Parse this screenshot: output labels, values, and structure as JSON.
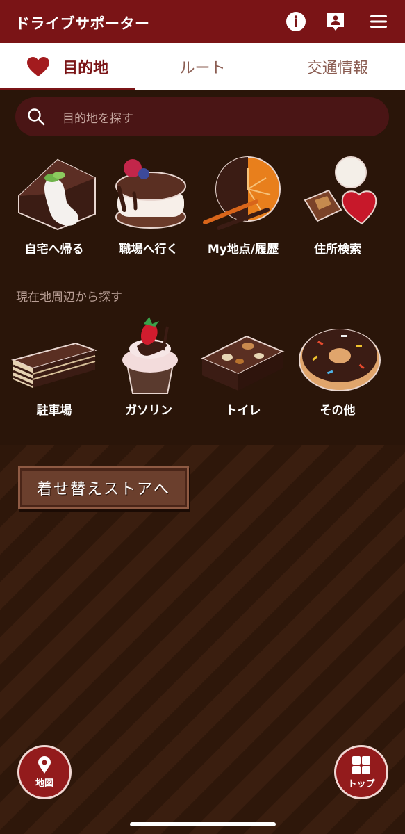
{
  "header": {
    "title": "ドライブサポーター"
  },
  "tabs": [
    {
      "label": "目的地"
    },
    {
      "label": "ルート"
    },
    {
      "label": "交通情報"
    }
  ],
  "search": {
    "placeholder": "目的地を探す"
  },
  "shortcuts": [
    {
      "label": "自宅へ帰る",
      "icon": "chocolate-cake-icon"
    },
    {
      "label": "職場へ行く",
      "icon": "macaron-icon"
    },
    {
      "label": "My地点/履歴",
      "icon": "orange-chocolate-icon"
    },
    {
      "label": "住所検索",
      "icon": "bonbon-chocolates-icon"
    }
  ],
  "nearby": {
    "title": "現在地周辺から探す",
    "items": [
      {
        "label": "駐車場",
        "icon": "opera-cake-icon"
      },
      {
        "label": "ガソリン",
        "icon": "cupcake-icon"
      },
      {
        "label": "トイレ",
        "icon": "brownie-icon"
      },
      {
        "label": "その他",
        "icon": "donut-icon"
      }
    ]
  },
  "store_button": {
    "label": "着せ替えストアへ"
  },
  "fabs": {
    "map_label": "地図",
    "top_label": "トップ"
  },
  "colors": {
    "header": "#7a1416",
    "background": "#2a1509",
    "accent": "#931b1c"
  }
}
